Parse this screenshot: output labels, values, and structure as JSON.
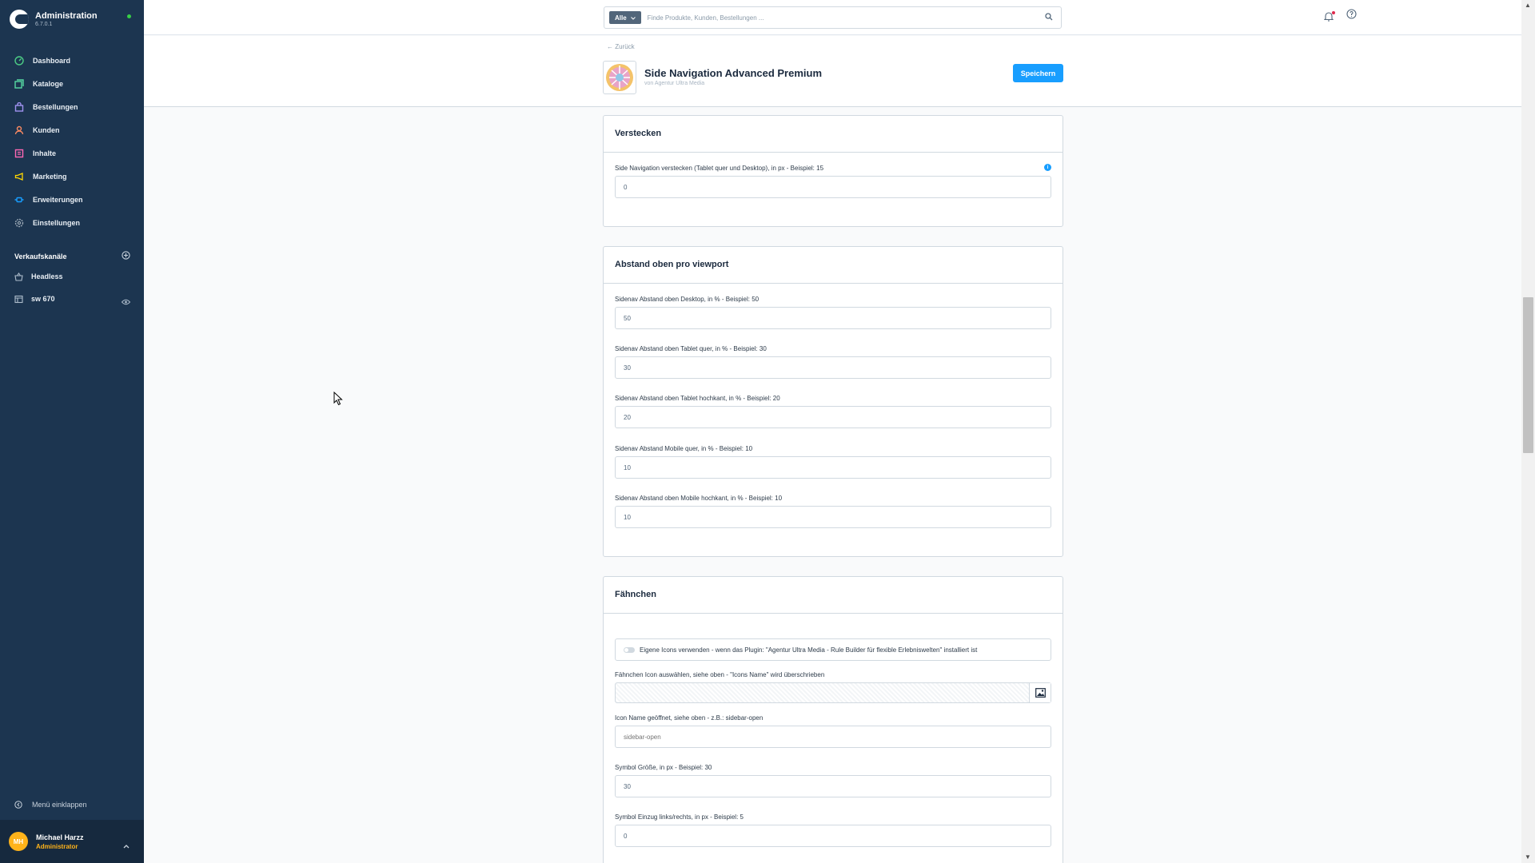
{
  "app": {
    "title": "Administration",
    "version": "6.7.0.1"
  },
  "sidebar": {
    "nav": [
      {
        "label": "Dashboard",
        "icon": "dashboard-icon",
        "color": "#4ccd85"
      },
      {
        "label": "Kataloge",
        "icon": "catalog-icon",
        "color": "#57d9a3"
      },
      {
        "label": "Bestellungen",
        "icon": "shopping-bag-icon",
        "color": "#a092f0"
      },
      {
        "label": "Kunden",
        "icon": "customers-icon",
        "color": "#f88962"
      },
      {
        "label": "Inhalte",
        "icon": "content-icon",
        "color": "#ff68b4"
      },
      {
        "label": "Marketing",
        "icon": "megaphone-icon",
        "color": "#ffd700"
      },
      {
        "label": "Erweiterungen",
        "icon": "plug-icon",
        "color": "#189eff"
      },
      {
        "label": "Einstellungen",
        "icon": "gear-icon",
        "color": "#9aa8b5"
      }
    ],
    "channels_title": "Verkaufskanäle",
    "channels": [
      {
        "label": "Headless",
        "icon": "basket-icon"
      },
      {
        "label": "sw 670",
        "icon": "storefront-icon"
      }
    ],
    "collapse_label": "Menü einklappen",
    "user": {
      "initials": "MH",
      "name": "Michael Harzz",
      "role": "Administrator"
    }
  },
  "topbar": {
    "search_type": "Alle",
    "search_placeholder": "Finde Produkte, Kunden, Bestellungen ..."
  },
  "header": {
    "back_label": "← Zurück",
    "plugin_title": "Side Navigation Advanced Premium",
    "plugin_vendor": "von Agentur Ultra Media",
    "save_label": "Speichern"
  },
  "cards": {
    "hide": {
      "title": "Verstecken",
      "field_label": "Side Navigation verstecken (Tablet quer und Desktop), in px - Beispiel: 15",
      "field_value": "0"
    },
    "spacing": {
      "title": "Abstand oben pro viewport",
      "fields": [
        {
          "label": "Sidenav Abstand oben Desktop, in % - Beispiel: 50",
          "value": "50"
        },
        {
          "label": "Sidenav Abstand oben Tablet quer, in % - Beispiel: 30",
          "value": "30"
        },
        {
          "label": "Sidenav Abstand oben Tablet hochkant, in % - Beispiel: 20",
          "value": "20"
        },
        {
          "label": "Sidenav Abstand Mobile quer, in % - Beispiel: 10",
          "value": "10"
        },
        {
          "label": "Sidenav Abstand oben Mobile hochkant, in % - Beispiel: 10",
          "value": "10"
        }
      ]
    },
    "flag": {
      "title": "Fähnchen",
      "toggle_label": "Eigene Icons verwenden - wenn das Plugin: \"Agentur Ultra Media - Rule Builder für flexible Erlebniswelten\" installiert ist",
      "media_label": "Fähnchen Icon auswählen, siehe oben - \"Icons Name\" wird überschrieben",
      "icon_name_label": "Icon Name geöffnet, siehe oben - z.B.: sidebar-open",
      "icon_name_placeholder": "sidebar-open",
      "size_label": "Symbol Größe, in px - Beispiel: 30",
      "size_value": "30",
      "indent_label": "Symbol Einzug links/rechts, in px - Beispiel: 5",
      "indent_value": "0"
    }
  }
}
